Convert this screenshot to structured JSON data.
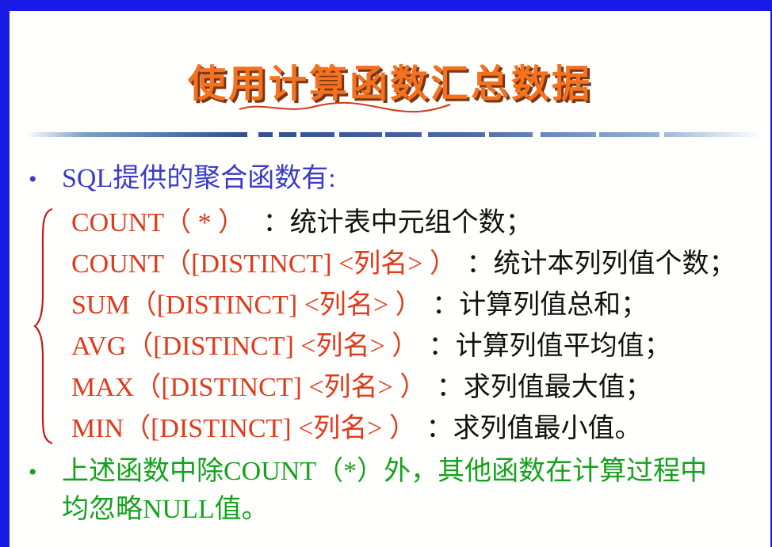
{
  "title": "使用计算函数汇总数据",
  "intro": "SQL提供的聚合函数有:",
  "functions": [
    {
      "code": "COUNT（ * ）",
      "desc": "：统计表中元组个数；"
    },
    {
      "code": "COUNT（[DISTINCT] <列名> ）",
      "desc": "：统计本列列值个数；"
    },
    {
      "code": "SUM（[DISTINCT] <列名> ）",
      "desc": "：计算列值总和；"
    },
    {
      "code": "AVG（[DISTINCT] <列名> ）",
      "desc": "：计算列值平均值；"
    },
    {
      "code": "MAX（[DISTINCT] <列名> ）",
      "desc": "：求列值最大值；"
    },
    {
      "code": "MIN（[DISTINCT] <列名> ）",
      "desc": "：求列值最小值。"
    }
  ],
  "note": {
    "line1": "上述函数中除COUNT（*）外，其他函数在计算过程中",
    "line2": "均忽略NULL值。"
  },
  "colors": {
    "border": "#1a1ae6",
    "title": "#f4711e",
    "intro": "#3b3bc7",
    "code": "#e03a1a",
    "desc": "#111111",
    "note": "#15a11c"
  }
}
